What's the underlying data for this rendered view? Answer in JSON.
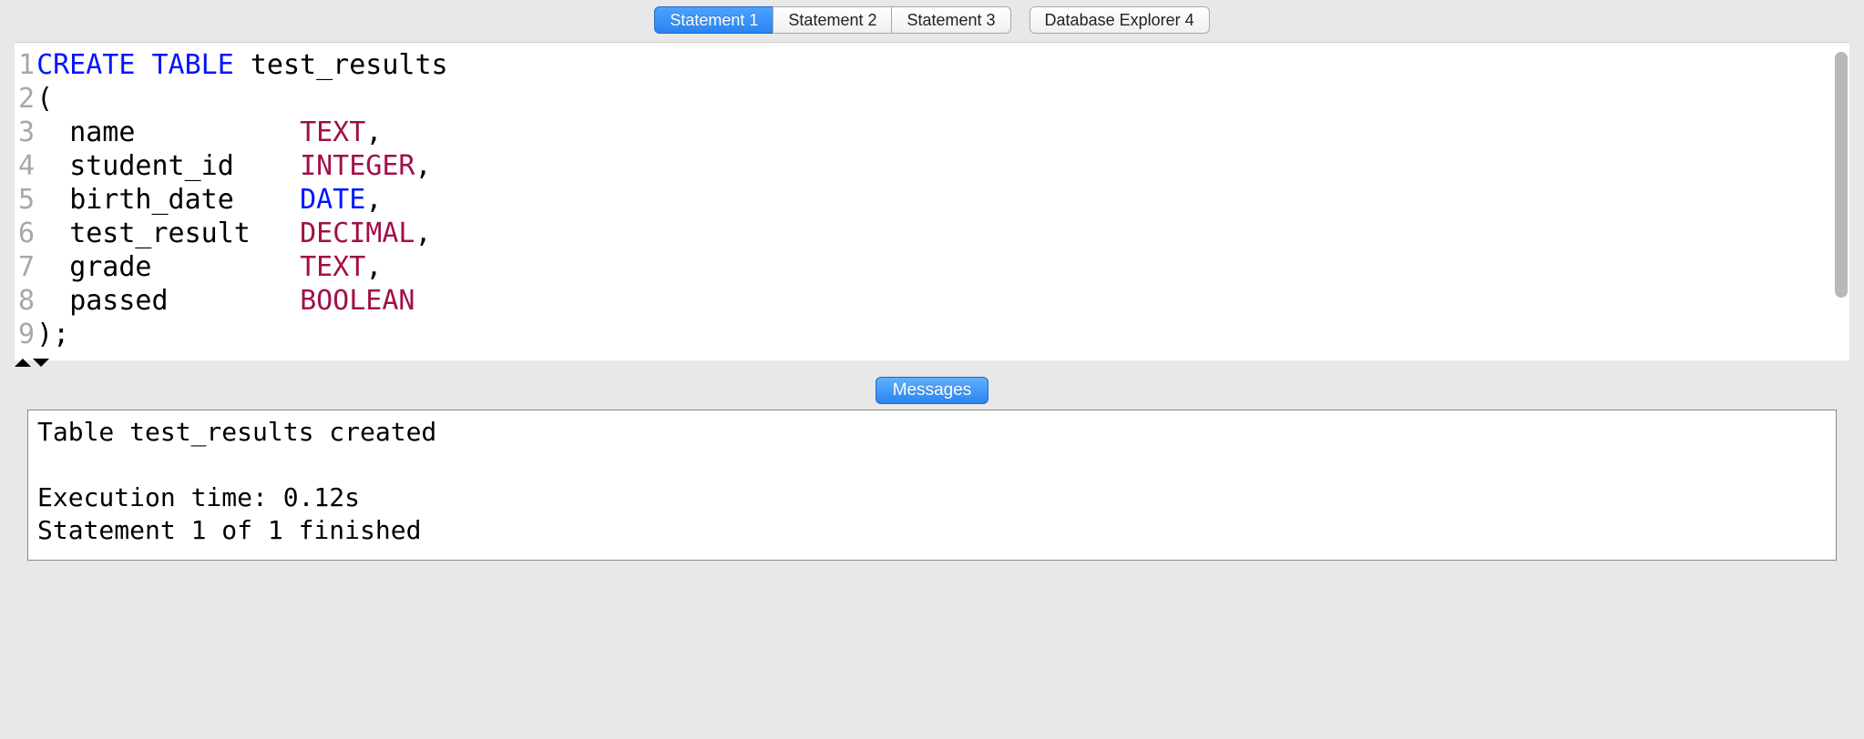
{
  "tabs": {
    "items": [
      {
        "label": "Statement 1",
        "active": true
      },
      {
        "label": "Statement 2",
        "active": false
      },
      {
        "label": "Statement 3",
        "active": false
      }
    ],
    "explorer": {
      "label": "Database Explorer 4"
    }
  },
  "editor": {
    "line_count": 9,
    "lines": {
      "l1": {
        "kw1": "CREATE",
        "kw2": "TABLE",
        "ident": "test_results"
      },
      "l2": "(",
      "l3": {
        "col": "name",
        "type": "TEXT",
        "comma": ","
      },
      "l4": {
        "col": "student_id",
        "type": "INTEGER",
        "comma": ","
      },
      "l5": {
        "col": "birth_date",
        "type": "DATE",
        "comma": ","
      },
      "l6": {
        "col": "test_result",
        "type": "DECIMAL",
        "comma": ","
      },
      "l7": {
        "col": "grade",
        "type": "TEXT",
        "comma": ","
      },
      "l8": {
        "col": "passed",
        "type": "BOOLEAN",
        "comma": ""
      },
      "l9": ");"
    }
  },
  "messages_tab": {
    "label": "Messages"
  },
  "messages": {
    "line1": "Table test_results created",
    "line2": "",
    "line3": "Execution time: 0.12s",
    "line4": "Statement 1 of 1 finished"
  }
}
